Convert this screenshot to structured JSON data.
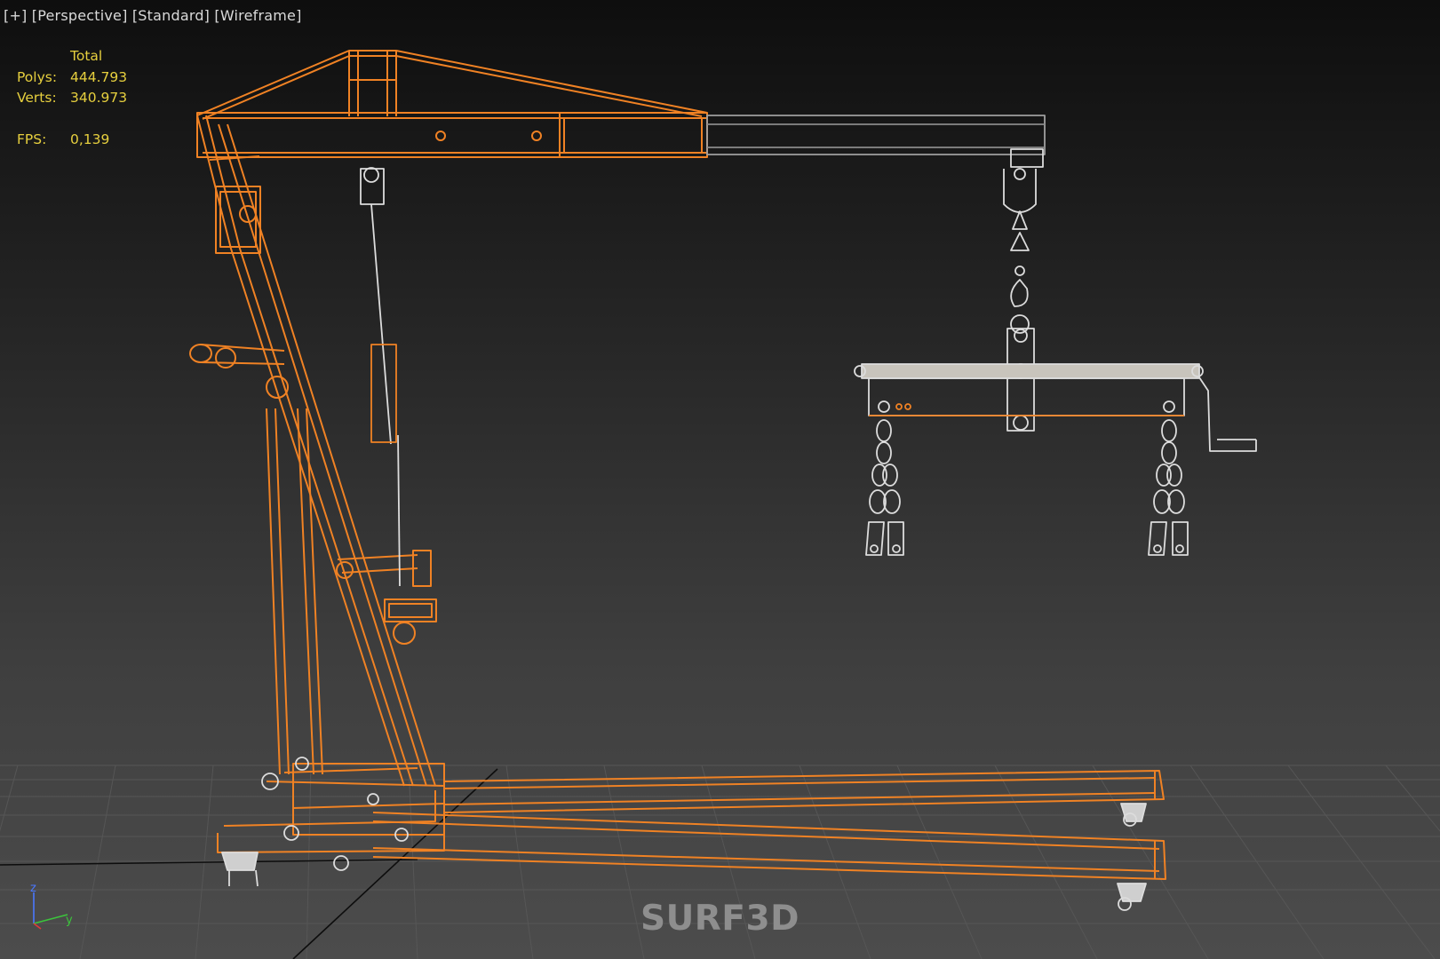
{
  "viewport": {
    "label": {
      "plus": "[+]",
      "view": "[Perspective]",
      "shading": "[Standard]",
      "mode": "[Wireframe]"
    }
  },
  "stats": {
    "header": "Total",
    "polys_label": "Polys:",
    "polys_value": "444.793",
    "verts_label": "Verts:",
    "verts_value": "340.973",
    "fps_label": "FPS:",
    "fps_value": "0,139"
  },
  "axis": {
    "z": "z",
    "y": "y"
  },
  "watermark": "SURF3D",
  "colors": {
    "selected_wire": "#f08224",
    "unselected_wire": "#dcdcdc",
    "grid": "#565656",
    "stats_text": "#e6cf3e",
    "axis_z": "#4a78ff",
    "axis_y": "#3cc43c",
    "axis_x": "#e03a3a"
  }
}
